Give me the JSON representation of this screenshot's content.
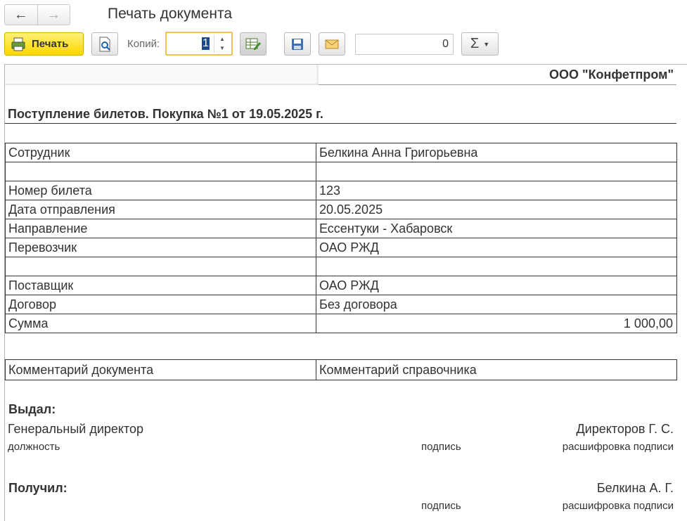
{
  "window": {
    "title": "Печать документа"
  },
  "toolbar": {
    "print_label": "Печать",
    "copies_label": "Копий:",
    "copies_value": "1",
    "sum_value": "0",
    "sum_menu_icon": "Σ"
  },
  "document": {
    "organization": "ООО \"Конфетпром\"",
    "title": "Поступление билетов. Покупка №1 от 19.05.2025 г.",
    "rows": [
      {
        "label": "Сотрудник",
        "value": "Белкина Анна Григорьевна"
      },
      {
        "label": "",
        "value": ""
      },
      {
        "label": "Номер билета",
        "value": "123"
      },
      {
        "label": "Дата отправления",
        "value": "20.05.2025"
      },
      {
        "label": "Направление",
        "value": "Ессентуки - Хабаровск"
      },
      {
        "label": "Перевозчик",
        "value": "ОАО РЖД"
      },
      {
        "label": "",
        "value": ""
      },
      {
        "label": "Поставщик",
        "value": "ОАО РЖД"
      },
      {
        "label": "Договор",
        "value": "Без договора"
      },
      {
        "label": "Сумма",
        "value": "1 000,00"
      }
    ],
    "comment": {
      "left": "Комментарий документа",
      "right": "Комментарий справочника"
    },
    "issued": {
      "heading": "Выдал:",
      "position": "Генеральный директор",
      "name": "Директоров Г. С.",
      "position_caption": "должность",
      "signature_caption": "подпись",
      "decode_caption": "расшифровка подписи"
    },
    "received": {
      "heading": "Получил:",
      "name": "Белкина А. Г.",
      "signature_caption": "подпись",
      "decode_caption": "расшифровка подписи"
    }
  }
}
